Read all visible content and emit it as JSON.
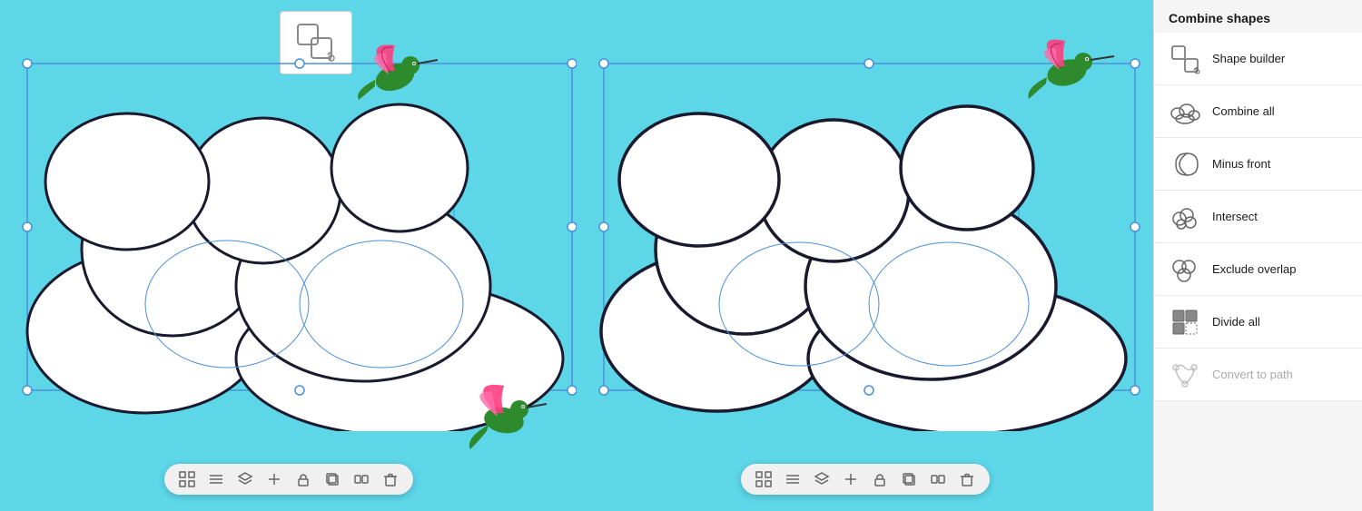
{
  "sidebar": {
    "title": "Combine shapes",
    "items": [
      {
        "id": "shape-builder",
        "label": "Shape builder",
        "icon": "shape-builder-icon",
        "disabled": false,
        "active": false
      },
      {
        "id": "combine-all",
        "label": "Combine all",
        "icon": "combine-all-icon",
        "disabled": false,
        "active": false
      },
      {
        "id": "minus-front",
        "label": "Minus front",
        "icon": "minus-front-icon",
        "disabled": false,
        "active": false
      },
      {
        "id": "intersect",
        "label": "Intersect",
        "icon": "intersect-icon",
        "disabled": false,
        "active": false
      },
      {
        "id": "exclude-overlap",
        "label": "Exclude overlap",
        "icon": "exclude-overlap-icon",
        "disabled": false,
        "active": false
      },
      {
        "id": "divide-all",
        "label": "Divide all",
        "icon": "divide-all-icon",
        "disabled": false,
        "active": false
      },
      {
        "id": "convert-to-path",
        "label": "Convert to path",
        "icon": "convert-to-path-icon",
        "disabled": true,
        "active": false
      }
    ]
  },
  "toolbar": {
    "icons": [
      "grid",
      "menu",
      "layers",
      "plus",
      "lock",
      "duplicate",
      "group",
      "trash"
    ]
  }
}
